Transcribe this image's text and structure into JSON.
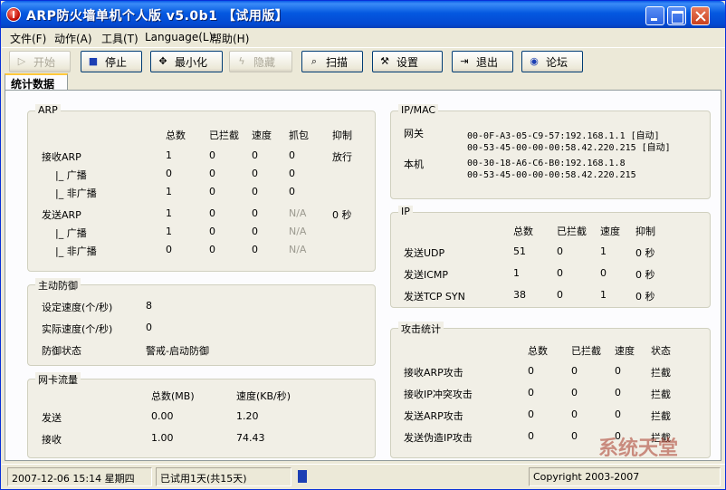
{
  "window": {
    "title": "ARP防火墙单机个人版 v5.0b1 【试用版】"
  },
  "menu": [
    "文件(F)",
    "动作(A)",
    "工具(T)",
    "Language(L)",
    "帮助(H)"
  ],
  "toolbar": {
    "start": "开始",
    "stop": "停止",
    "minimize": "最小化",
    "hide": "隐藏",
    "scan": "扫描",
    "settings": "设置",
    "exit": "退出",
    "forum": "论坛"
  },
  "tab": {
    "label": "统计数据"
  },
  "arp": {
    "title": "ARP",
    "headers": [
      "总数",
      "已拦截",
      "速度",
      "抓包",
      "抑制"
    ],
    "rows": [
      {
        "label": "接收ARP",
        "v": [
          "1",
          "0",
          "0",
          "0",
          "放行"
        ]
      },
      {
        "label": "|_ 广播",
        "v": [
          "0",
          "0",
          "0",
          "0",
          ""
        ]
      },
      {
        "label": "|_ 非广播",
        "v": [
          "1",
          "0",
          "0",
          "0",
          ""
        ]
      },
      {
        "label": "发送ARP",
        "v": [
          "1",
          "0",
          "0",
          "N/A",
          "0 秒"
        ]
      },
      {
        "label": "|_ 广播",
        "v": [
          "1",
          "0",
          "0",
          "N/A",
          ""
        ]
      },
      {
        "label": "|_ 非广播",
        "v": [
          "0",
          "0",
          "0",
          "N/A",
          ""
        ]
      }
    ]
  },
  "defense": {
    "title": "主动防御",
    "rows": [
      {
        "label": "设定速度(个/秒)",
        "value": "8"
      },
      {
        "label": "实际速度(个/秒)",
        "value": "0"
      },
      {
        "label": "防御状态",
        "value": "警戒-启动防御"
      }
    ]
  },
  "nic": {
    "title": "网卡流量",
    "headers": [
      "总数(MB)",
      "速度(KB/秒)"
    ],
    "rows": [
      {
        "label": "发送",
        "total": "0.00",
        "speed": "1.20"
      },
      {
        "label": "接收",
        "total": "1.00",
        "speed": "74.43"
      }
    ]
  },
  "ipmac": {
    "title": "IP/MAC",
    "gateway_label": "网关",
    "gateway": [
      "00-0F-A3-05-C9-57:192.168.1.1 [自动]",
      "00-53-45-00-00-00:58.42.220.215 [自动]"
    ],
    "local_label": "本机",
    "local": [
      "00-30-18-A6-C6-B0:192.168.1.8",
      "00-53-45-00-00-00:58.42.220.215"
    ]
  },
  "ip": {
    "title": "IP",
    "headers": [
      "总数",
      "已拦截",
      "速度",
      "抑制"
    ],
    "rows": [
      {
        "label": "发送UDP",
        "v": [
          "51",
          "0",
          "1",
          "0 秒"
        ]
      },
      {
        "label": "发送ICMP",
        "v": [
          "1",
          "0",
          "0",
          "0 秒"
        ]
      },
      {
        "label": "发送TCP SYN",
        "v": [
          "38",
          "0",
          "1",
          "0 秒"
        ]
      }
    ]
  },
  "attack": {
    "title": "攻击统计",
    "headers": [
      "总数",
      "已拦截",
      "速度",
      "状态"
    ],
    "rows": [
      {
        "label": "接收ARP攻击",
        "v": [
          "0",
          "0",
          "0",
          "拦截"
        ]
      },
      {
        "label": "接收IP冲突攻击",
        "v": [
          "0",
          "0",
          "0",
          "拦截"
        ]
      },
      {
        "label": "发送ARP攻击",
        "v": [
          "0",
          "0",
          "0",
          "拦截"
        ]
      },
      {
        "label": "发送伪造IP攻击",
        "v": [
          "0",
          "0",
          "0",
          "拦截"
        ]
      }
    ]
  },
  "status": {
    "datetime": "2007-12-06 15:14 星期四",
    "trial": "已试用1天(共15天)",
    "progress_fraction": 0.04,
    "copyright": "Copyright 2003-2007"
  },
  "watermark": "系统天堂"
}
